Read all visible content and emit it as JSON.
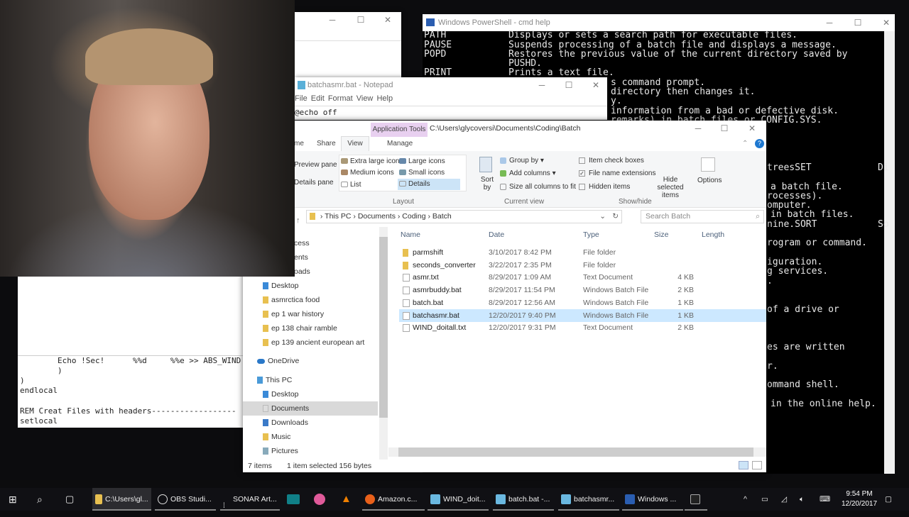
{
  "powershell": {
    "title": "Windows PowerShell - cmd  help",
    "lines": [
      {
        "cmd": "PATH",
        "desc": "Displays or sets a search path for executable files."
      },
      {
        "cmd": "PAUSE",
        "desc": "Suspends processing of a batch file and displays a message."
      },
      {
        "cmd": "POPD",
        "desc": "Restores the previous value of the current directory saved by"
      },
      {
        "cmd": "",
        "desc": "PUSHD."
      },
      {
        "cmd": "PRINT",
        "desc": "Prints a text file."
      }
    ],
    "fragments_mid": [
      "s command prompt.",
      "directory then changes it.",
      "y.",
      "information from a bad or defective disk.",
      "remarks) in batch files or CONFIG.SYS."
    ],
    "fragments_right": [
      "treesSET",
      "Di",
      "a batch file.",
      "rocesses).",
      "omputer.",
      "in batch files.",
      "nine.SORT",
      "So",
      "rogram or command.",
      "iguration.",
      "g services.",
      ".",
      "of a drive or",
      "es are written",
      "r.",
      "ommand shell.",
      "in the online help."
    ]
  },
  "notepad": {
    "title": "batchasmr.bat - Notepad",
    "menu": [
      "File",
      "Edit",
      "Format",
      "View",
      "Help"
    ],
    "text": "@echo off"
  },
  "notepad2": {
    "lines": [
      "        Echo !Sec!      %%d     %%e >> ABS_WIND",
      "        )",
      ")",
      "endlocal",
      "",
      "REM Creat Files with headers------------------",
      "setlocal"
    ]
  },
  "explorer": {
    "context_tab": "Application Tools",
    "title": "C:\\Users\\glycoversi\\Documents\\Coding\\Batch",
    "tabs": [
      "me",
      "Share",
      "View",
      "Manage"
    ],
    "ribbon": {
      "panes": [
        "Preview pane",
        "Details pane"
      ],
      "layout": [
        "Extra large icons",
        "Large icons",
        "Medium icons",
        "Small icons",
        "List",
        "Details"
      ],
      "sort": "Sort by",
      "current_view": [
        "Group by",
        "Add columns",
        "Size all columns to fit"
      ],
      "showhide": [
        "Item check boxes",
        "File name extensions",
        "Hidden items"
      ],
      "hide_selected": "Hide selected items",
      "options": "Options",
      "groups": [
        "Layout",
        "Current view",
        "Show/hide"
      ]
    },
    "breadcrumb": [
      "This PC",
      "Documents",
      "Coding",
      "Batch"
    ],
    "search_placeholder": "Search Batch",
    "columns": [
      "Name",
      "Date",
      "Type",
      "Size",
      "Length"
    ],
    "files": [
      {
        "name": "parmshift",
        "date": "3/10/2017 8:42 PM",
        "type": "File folder",
        "size": ""
      },
      {
        "name": "seconds_converter",
        "date": "3/22/2017 2:35 PM",
        "type": "File folder",
        "size": ""
      },
      {
        "name": "asmr.txt",
        "date": "8/29/2017 1:09 AM",
        "type": "Text Document",
        "size": "4 KB"
      },
      {
        "name": "asmrbuddy.bat",
        "date": "8/29/2017 11:54 PM",
        "type": "Windows Batch File",
        "size": "2 KB"
      },
      {
        "name": "batch.bat",
        "date": "8/29/2017 12:56 AM",
        "type": "Windows Batch File",
        "size": "1 KB"
      },
      {
        "name": "batchasmr.bat",
        "date": "12/20/2017 9:40 PM",
        "type": "Windows Batch File",
        "size": "1 KB"
      },
      {
        "name": "WIND_doitall.txt",
        "date": "12/20/2017 9:31 PM",
        "type": "Text Document",
        "size": "2 KB"
      }
    ],
    "nav": [
      "cess",
      "ents",
      "oads",
      "Desktop",
      "asmrctica food",
      "ep 1 war history",
      "ep 138 chair ramble",
      "ep 139 ancient european art",
      "OneDrive",
      "This PC",
      "Desktop",
      "Documents",
      "Downloads",
      "Music",
      "Pictures"
    ],
    "status": {
      "items": "7 items",
      "selected": "1 item selected  156 bytes"
    }
  },
  "taskbar": {
    "items": [
      "C:\\Users\\gl...",
      "OBS Studi...",
      "SONAR Art...",
      "Amazon.c...",
      "WIND_doit...",
      "batch.bat -...",
      "batchasmr...",
      "Windows ..."
    ],
    "time": "9:54 PM",
    "date": "12/20/2017"
  }
}
